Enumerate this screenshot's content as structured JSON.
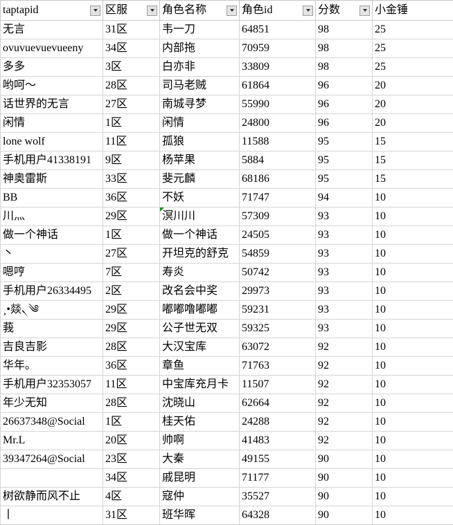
{
  "table": {
    "columns": [
      {
        "key": "taptapid",
        "label": "taptapid",
        "filter": true,
        "align": "left"
      },
      {
        "key": "qufu",
        "label": "区服",
        "filter": true,
        "align": "left"
      },
      {
        "key": "name",
        "label": "角色名称",
        "filter": true,
        "align": "left"
      },
      {
        "key": "roleid",
        "label": "角色id",
        "filter": true,
        "align": "right"
      },
      {
        "key": "score",
        "label": "分数",
        "filter": true,
        "align": "right"
      },
      {
        "key": "hammer",
        "label": "小金锤",
        "filter": false,
        "align": "right"
      }
    ],
    "filter_icon": "dropdown-arrow-icon",
    "rows": [
      {
        "taptapid": "无言",
        "qufu": "31区",
        "name": "韦一刀",
        "roleid": "64851",
        "score": "98",
        "hammer": "25"
      },
      {
        "taptapid": "ovuvuevuevueeny",
        "qufu": "34区",
        "name": "内部拖",
        "roleid": "70959",
        "score": "98",
        "hammer": "25"
      },
      {
        "taptapid": "多多",
        "qufu": "3区",
        "name": "白亦非",
        "roleid": "33809",
        "score": "98",
        "hammer": "25"
      },
      {
        "taptapid": "哟呵～",
        "qufu": "28区",
        "name": "司马老贼",
        "roleid": "61864",
        "score": "96",
        "hammer": "20"
      },
      {
        "taptapid": "话世界的无言",
        "qufu": "27区",
        "name": "南城寻梦",
        "roleid": "55990",
        "score": "96",
        "hammer": "20"
      },
      {
        "taptapid": "闲情",
        "qufu": "1区",
        "name": "闲情",
        "roleid": "24800",
        "score": "96",
        "hammer": "20"
      },
      {
        "taptapid": "lone wolf",
        "qufu": "11区",
        "name": "孤狼",
        "roleid": "11588",
        "score": "95",
        "hammer": "15"
      },
      {
        "taptapid": "手机用户41338191",
        "qufu": "9区",
        "name": "杨苹果",
        "roleid": "5884",
        "score": "95",
        "hammer": "15"
      },
      {
        "taptapid": "神奥雷斯",
        "qufu": "33区",
        "name": "斐元麟",
        "roleid": "68186",
        "score": "95",
        "hammer": "15"
      },
      {
        "taptapid": "BB",
        "qufu": "36区",
        "name": "不妖",
        "roleid": "71747",
        "score": "94",
        "hammer": "10"
      },
      {
        "taptapid": "川灬",
        "qufu": "29区",
        "name": "溟川川",
        "roleid": "57309",
        "score": "93",
        "hammer": "10",
        "name_error_flag": true
      },
      {
        "taptapid": "做一个神话",
        "qufu": "1区",
        "name": "做一个神话",
        "roleid": "24505",
        "score": "93",
        "hammer": "10"
      },
      {
        "taptapid": "丶",
        "qufu": "27区",
        "name": "开坦克的舒克",
        "roleid": "54859",
        "score": "93",
        "hammer": "10"
      },
      {
        "taptapid": "嗯哼",
        "qufu": "7区",
        "name": "寿炎",
        "roleid": "50742",
        "score": "93",
        "hammer": "10"
      },
      {
        "taptapid": "手机用户26334495",
        "qufu": "2区",
        "name": "改名会中奖",
        "roleid": "29973",
        "score": "93",
        "hammer": "10"
      },
      {
        "taptapid": "¸•燚৲༄",
        "qufu": "29区",
        "name": "嘟嘟噜嘟嘟",
        "roleid": "59231",
        "score": "93",
        "hammer": "10"
      },
      {
        "taptapid": "莪",
        "qufu": "29区",
        "name": "公子世无双",
        "roleid": "59325",
        "score": "93",
        "hammer": "10"
      },
      {
        "taptapid": "吉良吉影",
        "qufu": "28区",
        "name": "大汉宝库",
        "roleid": "63072",
        "score": "92",
        "hammer": "10"
      },
      {
        "taptapid": "华年。",
        "qufu": "36区",
        "name": "章鱼",
        "roleid": "71763",
        "score": "92",
        "hammer": "10"
      },
      {
        "taptapid": "手机用户32353057",
        "qufu": "11区",
        "name": "中宝库充月卡",
        "roleid": "11507",
        "score": "92",
        "hammer": "10"
      },
      {
        "taptapid": "年少无知",
        "qufu": "28区",
        "name": "沈晓山",
        "roleid": "62664",
        "score": "92",
        "hammer": "10"
      },
      {
        "taptapid": "26637348@Social",
        "qufu": "1区",
        "name": "桂天佑",
        "roleid": "24288",
        "score": "92",
        "hammer": "10"
      },
      {
        "taptapid": "Mr.L",
        "qufu": "20区",
        "name": "帅啊",
        "roleid": "41483",
        "score": "92",
        "hammer": "10"
      },
      {
        "taptapid": "39347264@Social",
        "qufu": "23区",
        "name": "大秦",
        "roleid": "49155",
        "score": "90",
        "hammer": "10"
      },
      {
        "taptapid": "",
        "qufu": "34区",
        "name": "戚昆明",
        "roleid": "71177",
        "score": "90",
        "hammer": "10"
      },
      {
        "taptapid": "树欲静而风不止",
        "qufu": "4区",
        "name": "寇仲",
        "roleid": "35527",
        "score": "90",
        "hammer": "10"
      },
      {
        "taptapid": "丨",
        "qufu": "31区",
        "name": "班华晖",
        "roleid": "64328",
        "score": "90",
        "hammer": "10"
      }
    ]
  }
}
